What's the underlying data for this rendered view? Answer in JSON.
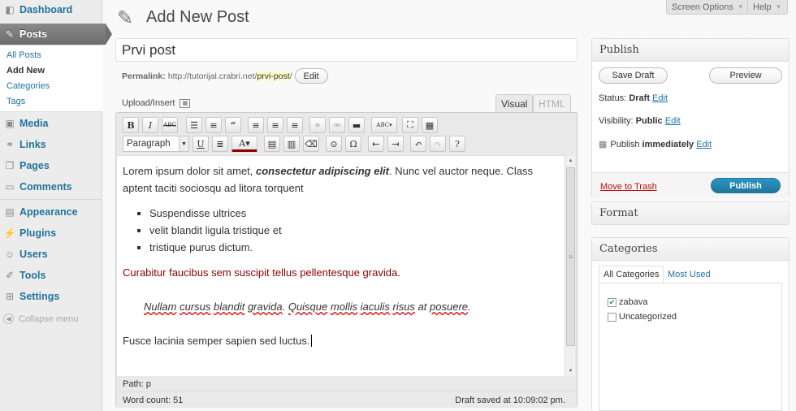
{
  "sidebar": {
    "dashboard": "Dashboard",
    "posts": "Posts",
    "submenu": [
      "All Posts",
      "Add New",
      "Categories",
      "Tags"
    ],
    "media": "Media",
    "links": "Links",
    "pages": "Pages",
    "comments": "Comments",
    "appearance": "Appearance",
    "plugins": "Plugins",
    "users": "Users",
    "tools": "Tools",
    "settings": "Settings",
    "collapse": "Collapse menu"
  },
  "header": {
    "title": "Add New Post",
    "screen_options": "Screen Options",
    "help": "Help"
  },
  "post": {
    "title_value": "Prvi post",
    "permalink_label": "Permalink:",
    "permalink_base": "http://tutorijal.crabri.net/",
    "permalink_slug": "prvi-post",
    "permalink_trail": "/",
    "permalink_edit": "Edit"
  },
  "editor": {
    "upload_insert": "Upload/Insert",
    "tab_visual": "Visual",
    "tab_html": "HTML",
    "format_select": "Paragraph",
    "content": {
      "p1_a": "Lorem ipsum dolor sit amet, ",
      "p1_bold": "consectetur adipiscing elit",
      "p1_b": ". Nunc vel auctor neque. Class aptent taciti sociosqu ad litora torquent",
      "list": [
        "Suspendisse ultrices",
        "velit blandit ligula tristique et",
        "tristique purus dictum."
      ],
      "p_red": "Curabitur faucibus sem suscipit tellus pellentesque gravida.",
      "p_indent_words": [
        "Nullam",
        "cursus",
        "blandit",
        "gravida",
        ". ",
        "Quisque",
        "mollis",
        "iaculis",
        "risus",
        "at",
        "posuere",
        "."
      ],
      "p_last": "Fusce lacinia semper sapien sed luctus."
    },
    "path_label": "Path:",
    "path_value": "p",
    "word_count": "Word count: 51",
    "draft_saved": "Draft saved at 10:09:02 pm."
  },
  "publish": {
    "title": "Publish",
    "save_draft": "Save Draft",
    "preview": "Preview",
    "status_label": "Status:",
    "status_value": "Draft",
    "visibility_label": "Visibility:",
    "visibility_value": "Public",
    "publish_label": "Publish",
    "publish_value": "immediately",
    "edit": "Edit",
    "trash": "Move to Trash",
    "publish_button": "Publish"
  },
  "format_box": {
    "title": "Format"
  },
  "categories": {
    "title": "Categories",
    "tab_all": "All Categories",
    "tab_used": "Most Used",
    "items": [
      {
        "label": "zabava",
        "checked": true
      },
      {
        "label": "Uncategorized",
        "checked": false
      }
    ]
  }
}
